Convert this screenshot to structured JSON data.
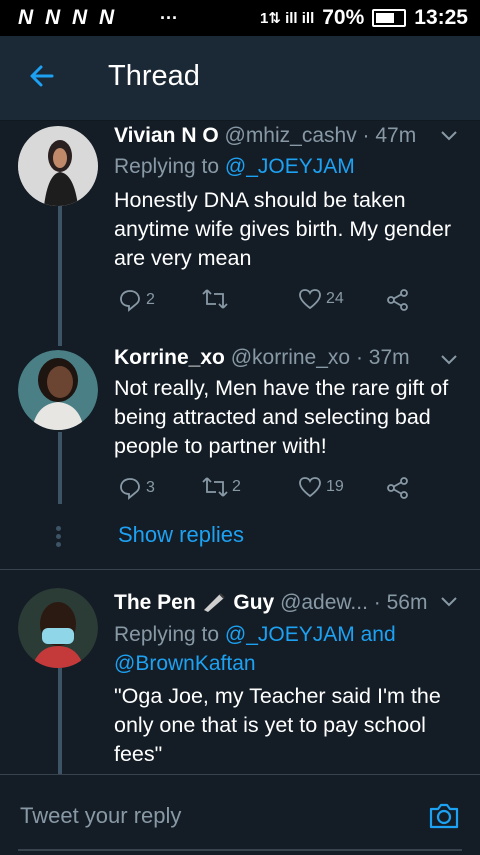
{
  "status_bar": {
    "carrier_icons": "N N N N",
    "dots": "···",
    "signal": "1⇅ ill ill",
    "battery_percent": "70%",
    "time": "13:25"
  },
  "header": {
    "title": "Thread"
  },
  "tweets": [
    {
      "name": "Vivian N O",
      "handle": "@mhiz_cashv",
      "time": "· 47m",
      "replying_prefix": "Replying to ",
      "replying_to": "@_JOEYJAM",
      "text": "Honestly DNA should be taken anytime wife gives birth. My gender are very mean",
      "replies": "2",
      "retweets": "",
      "likes": "24"
    },
    {
      "name": "Korrine_xo",
      "handle": "@korrine_xo",
      "time": "· 37m",
      "text": "Not really, Men have the rare gift of being attracted and selecting bad people to partner with!",
      "replies": "3",
      "retweets": "2",
      "likes": "19"
    },
    {
      "name": "The Pen",
      "name_suffix": "Guy",
      "handle": "@adew...",
      "time": "· 56m",
      "replying_prefix": "Replying to ",
      "replying_to": "@_JOEYJAM",
      "replying_joiner": " and",
      "replying_to_2": "@BrownKaftan",
      "text": "\"Oga Joe, my Teacher said I'm the only one that is yet to pay school fees\""
    }
  ],
  "show_replies": "Show replies",
  "reply_bar": {
    "placeholder": "Tweet your reply"
  },
  "colors": {
    "background": "#141d26",
    "app_bar": "#1b2836",
    "accent": "#1da1f2",
    "muted": "#8899a6"
  },
  "icons": [
    "back-arrow-icon",
    "chevron-down-icon",
    "reply-icon",
    "retweet-icon",
    "like-icon",
    "share-icon",
    "camera-icon",
    "pen-icon"
  ]
}
